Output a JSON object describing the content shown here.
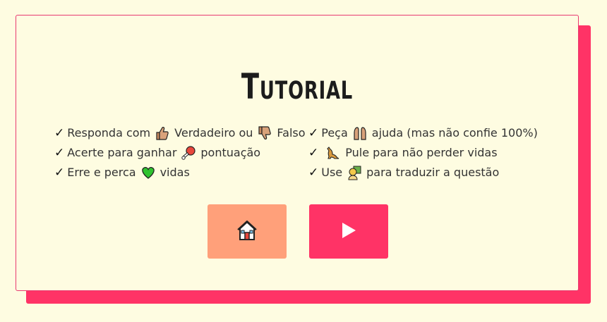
{
  "tutorial": {
    "title": "Tutorial",
    "left_items": [
      {
        "pre": "Responda com",
        "icon1": "thumbs-up-icon",
        "mid": "Verdadeiro ou",
        "icon2": "thumbs-down-icon",
        "post": "Falso"
      },
      {
        "pre": "Acerte para ganhar",
        "icon1": "meat-on-bone-icon",
        "post": "pontuação"
      },
      {
        "pre": "Erre e perca",
        "icon1": "green-heart-icon",
        "post": "vidas"
      }
    ],
    "right_items": [
      {
        "pre": "Peça",
        "icon1": "raised-hands-icon",
        "post": "ajuda (mas não confie 100%)"
      },
      {
        "pre": "",
        "icon1": "kangaroo-icon",
        "post": "Pule para não perder vidas"
      },
      {
        "pre": "Use",
        "icon1": "translator-person-icon",
        "post": "para traduzir a questão"
      }
    ],
    "check_mark": "✓"
  },
  "buttons": {
    "home_icon": "house-icon",
    "play_icon": "play-icon"
  },
  "colors": {
    "background": "#fefce1",
    "accent": "#ff3366",
    "home_button": "#ffa07a",
    "card_border": "#e83a70"
  }
}
